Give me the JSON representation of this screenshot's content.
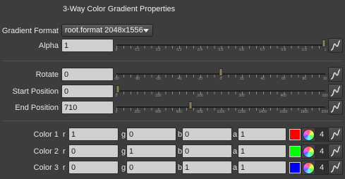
{
  "title": "3-Way Color Gradient Properties",
  "gradient_format": {
    "label": "Gradient Format",
    "value": "root.format 2048x1556"
  },
  "alpha": {
    "label": "Alpha",
    "value": "1",
    "ticks": [
      "0",
      "0.1",
      "0.2",
      "0.3",
      "0.4",
      "0.5",
      "0.6",
      "0.7",
      "0.8",
      "0.9",
      "1"
    ],
    "level": 1.0
  },
  "rotate": {
    "label": "Rotate",
    "value": "0",
    "ticks": [
      "-90",
      "-80",
      "-60",
      "-40",
      "-20",
      "0",
      "20",
      "40",
      "60",
      "80",
      "90"
    ],
    "level": 0.5
  },
  "start_position": {
    "label": "Start Position",
    "value": "0",
    "ticks": [
      "0",
      "100",
      "200",
      "300",
      "400",
      "500"
    ],
    "level": 0.0
  },
  "end_position": {
    "label": "End Position",
    "value": "710",
    "ticks": [
      "0",
      "200",
      "400",
      "600",
      "800",
      "1000",
      "1200",
      "1400",
      "1600",
      "1800",
      "2000"
    ],
    "level": 0.355
  },
  "colors": [
    {
      "label": "Color 1",
      "r": "1",
      "g": "0",
      "b": "0",
      "a": "1",
      "swatch": "#ff0000",
      "count": "4"
    },
    {
      "label": "Color 2",
      "r": "0",
      "g": "1",
      "b": "0",
      "a": "1",
      "swatch": "#00ff00",
      "count": "4"
    },
    {
      "label": "Color 3",
      "r": "0",
      "g": "0",
      "b": "1",
      "a": "1",
      "swatch": "#0000ff",
      "count": "4"
    }
  ],
  "channel_letters": {
    "r": "r",
    "g": "g",
    "b": "b",
    "a": "a"
  },
  "icons": {
    "curve": "curve-editor-icon",
    "wheel": "color-wheel-icon"
  }
}
